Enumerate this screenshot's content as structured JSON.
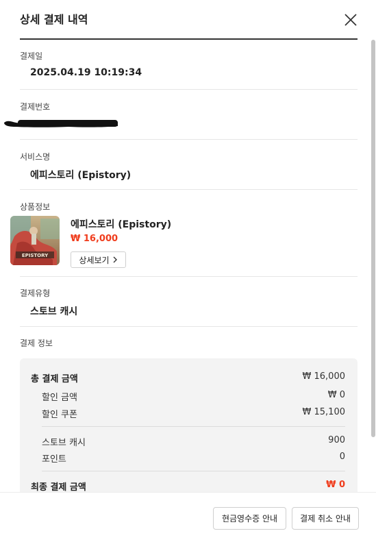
{
  "modal": {
    "title": "상세 결제 내역"
  },
  "fields": {
    "date_label": "결제일",
    "date_value": "2025.04.19 10:19:34",
    "payment_no_label": "결제번호",
    "service_label": "서비스명",
    "service_value": "에피스토리 (Epistory)",
    "product_label": "상품정보",
    "type_label": "결제유형",
    "type_value": "스토브 캐시",
    "pay_info_label": "결제 정보"
  },
  "product": {
    "name": "에피스토리 (Epistory)",
    "price": "₩ 16,000",
    "detail_button": "상세보기",
    "thumbnail_text": "EPISTORY"
  },
  "payment": {
    "total_label": "총 결제 금액",
    "total_value": "₩ 16,000",
    "discount_label": "할인 금액",
    "discount_value": "₩ 0",
    "coupon_label": "할인 쿠폰",
    "coupon_value": "₩ 15,100",
    "cash_label": "스토브 캐시",
    "cash_value": "900",
    "point_label": "포인트",
    "point_value": "0",
    "final_label": "최종 결제 금액",
    "final_value": "₩ 0"
  },
  "footer": {
    "receipt_button": "현금영수증 안내",
    "cancel_button": "결제 취소 안내"
  },
  "colors": {
    "accent_red": "#f03c1c",
    "box_bg": "#f3f3f3"
  }
}
